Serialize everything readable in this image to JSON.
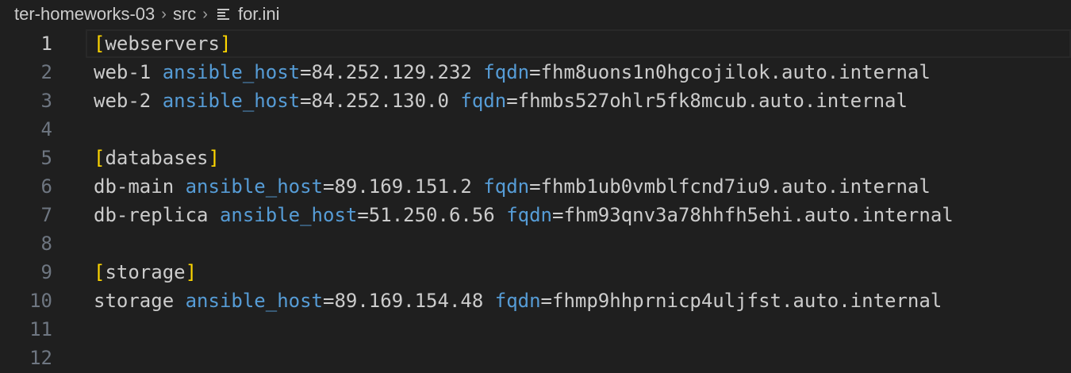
{
  "breadcrumb": {
    "items": [
      "ter-homeworks-03",
      "src",
      "for.ini"
    ],
    "file_icon": "lines-icon"
  },
  "colors": {
    "background": "#1f1f1f",
    "text": "#cccccc",
    "key": "#569cd6",
    "bracket": "#ffd700",
    "line_number": "#6e7681"
  },
  "editor": {
    "current_line": 1,
    "lines": [
      {
        "num": "1",
        "section": "webservers"
      },
      {
        "num": "2",
        "host": "web-1",
        "k1": "ansible_host",
        "v1": "84.252.129.232",
        "k2": "fqdn",
        "v2": "fhm8uons1n0hgcojilok.auto.internal"
      },
      {
        "num": "3",
        "host": "web-2",
        "k1": "ansible_host",
        "v1": "84.252.130.0",
        "k2": "fqdn",
        "v2": "fhmbs527ohlr5fk8mcub.auto.internal"
      },
      {
        "num": "4"
      },
      {
        "num": "5",
        "section": "databases"
      },
      {
        "num": "6",
        "host": "db-main",
        "k1": "ansible_host",
        "v1": "89.169.151.2",
        "k2": "fqdn",
        "v2": "fhmb1ub0vmblfcnd7iu9.auto.internal"
      },
      {
        "num": "7",
        "host": "db-replica",
        "k1": "ansible_host",
        "v1": "51.250.6.56",
        "k2": "fqdn",
        "v2": "fhm93qnv3a78hhfh5ehi.auto.internal"
      },
      {
        "num": "8"
      },
      {
        "num": "9",
        "section": "storage"
      },
      {
        "num": "10",
        "host": "storage",
        "k1": "ansible_host",
        "v1": "89.169.154.48",
        "k2": "fqdn",
        "v2": "fhmp9hhprnicp4uljfst.auto.internal"
      },
      {
        "num": "11"
      },
      {
        "num": "12"
      }
    ]
  }
}
